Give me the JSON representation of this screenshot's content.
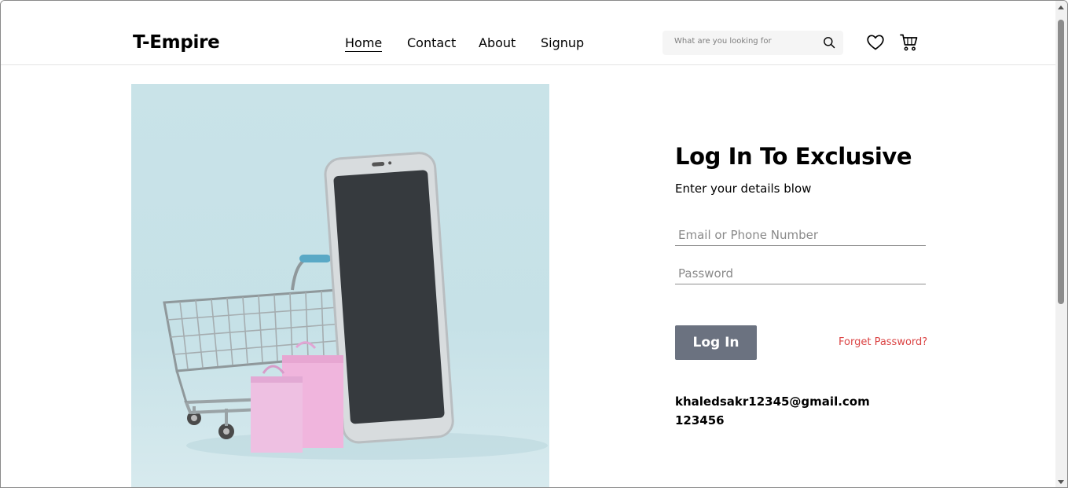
{
  "header": {
    "logo": "T-Empire",
    "nav": [
      {
        "label": "Home",
        "active": true
      },
      {
        "label": "Contact",
        "active": false
      },
      {
        "label": "About",
        "active": false
      },
      {
        "label": "Signup",
        "active": false
      }
    ],
    "search": {
      "placeholder": "What are you looking for",
      "icon": "search-icon"
    },
    "icons": [
      "heart-icon",
      "cart-icon"
    ]
  },
  "hero": {
    "image": "shopping-cart-and-phone-illustration"
  },
  "login": {
    "title": "Log In To Exclusive",
    "subtitle": "Enter your details blow",
    "email_placeholder": "Email or Phone Number",
    "password_placeholder": "Password",
    "button_label": "Log In",
    "forgot_label": "Forget Password?",
    "credentials_email": "khaledsakr12345@gmail.com",
    "credentials_password": "123456"
  },
  "colors": {
    "accent": "#DB4444",
    "button": "#6B7280",
    "hero_bg": "#C9E3E8"
  }
}
